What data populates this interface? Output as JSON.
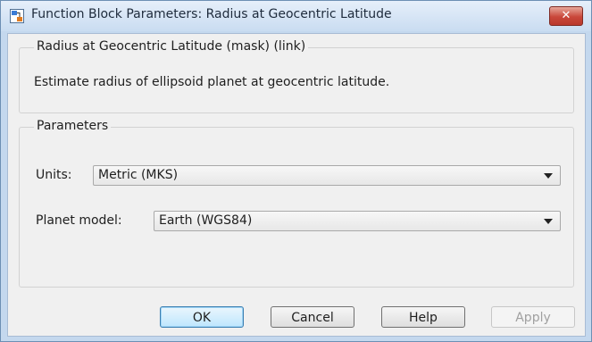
{
  "window": {
    "title": "Function Block Parameters: Radius at Geocentric Latitude",
    "close_glyph": "✕",
    "app_icon": "simulink-block-icon"
  },
  "description_group": {
    "legend": "Radius at Geocentric Latitude (mask) (link)",
    "text": "Estimate radius of ellipsoid planet at geocentric latitude."
  },
  "parameters_group": {
    "legend": "Parameters",
    "units": {
      "label": "Units:",
      "value": "Metric (MKS)"
    },
    "planet_model": {
      "label": "Planet model:",
      "value": "Earth (WGS84)"
    }
  },
  "buttons": {
    "ok": "OK",
    "cancel": "Cancel",
    "help": "Help",
    "apply": "Apply"
  },
  "colors": {
    "window_frame": "#c4d8ee",
    "close_button": "#c9473a",
    "default_button": "#bee6fd"
  }
}
